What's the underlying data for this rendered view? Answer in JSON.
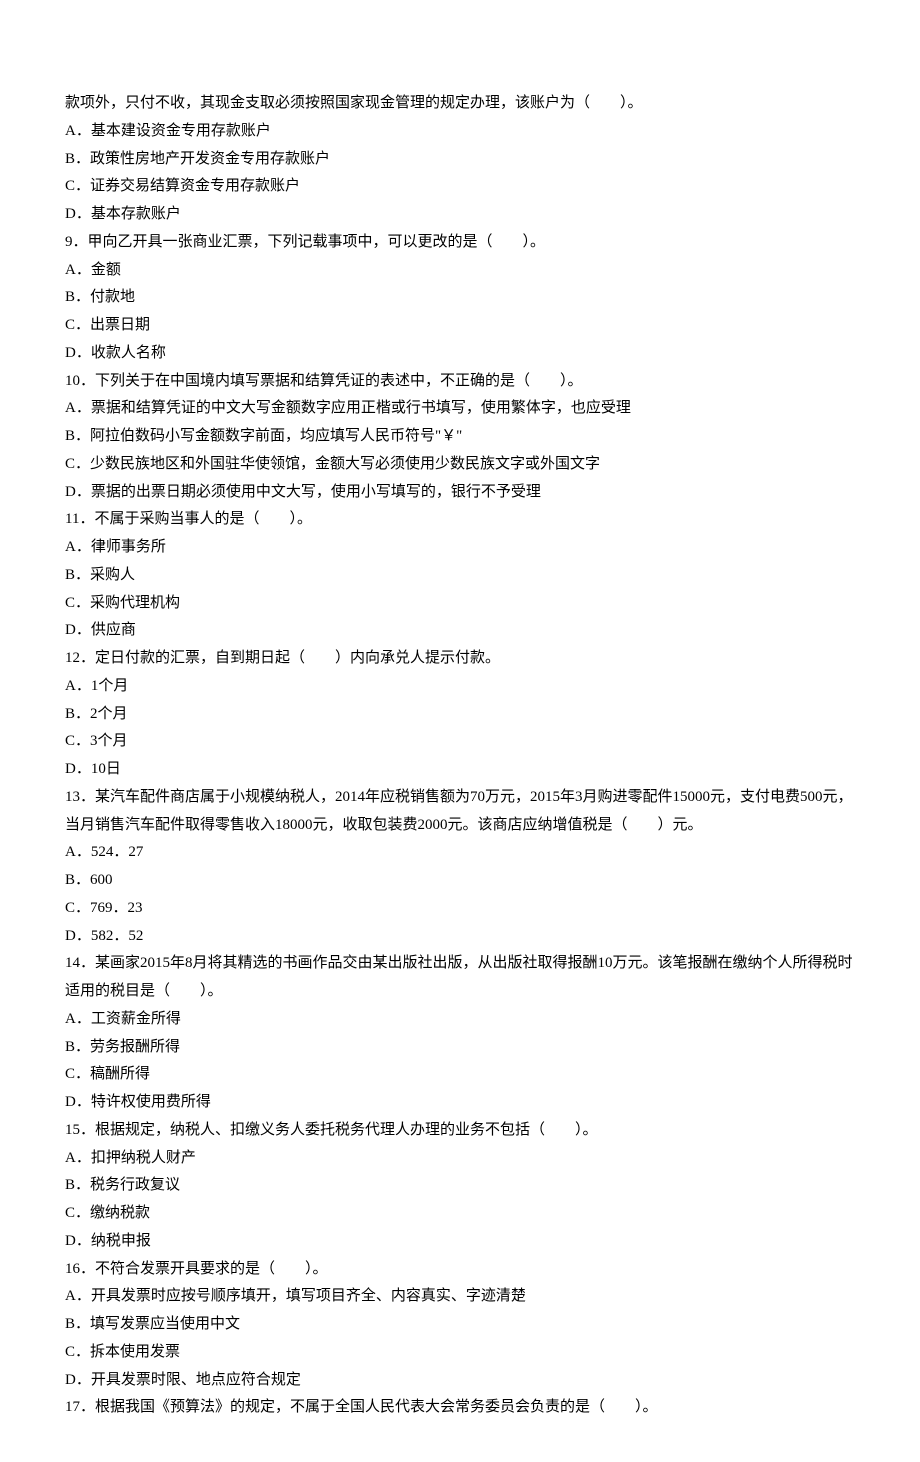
{
  "lines": [
    "款项外，只付不收，其现金支取必须按照国家现金管理的规定办理，该账户为（　　）。",
    "A．基本建设资金专用存款账户",
    "B．政策性房地产开发资金专用存款账户",
    "C．证券交易结算资金专用存款账户",
    "D．基本存款账户",
    "9．甲向乙开具一张商业汇票，下列记载事项中，可以更改的是（　　）。",
    "A．金额",
    "B．付款地",
    "C．出票日期",
    "D．收款人名称",
    "10．下列关于在中国境内填写票据和结算凭证的表述中，不正确的是（　　）。",
    "A．票据和结算凭证的中文大写金额数字应用正楷或行书填写，使用繁体字，也应受理",
    "B．阿拉伯数码小写金额数字前面，均应填写人民币符号\"￥\"",
    "C．少数民族地区和外国驻华使领馆，金额大写必须使用少数民族文字或外国文字",
    "D．票据的出票日期必须使用中文大写，使用小写填写的，银行不予受理",
    "11．不属于采购当事人的是（　　）。",
    "A．律师事务所",
    "B．采购人",
    "C．采购代理机构",
    "D．供应商",
    "12．定日付款的汇票，自到期日起（　　）内向承兑人提示付款。",
    "A．1个月",
    "B．2个月",
    "C．3个月",
    "D．10日",
    "13．某汽车配件商店属于小规模纳税人，2014年应税销售额为70万元，2015年3月购进零配件15000元，支付电费500元，当月销售汽车配件取得零售收入18000元，收取包装费2000元。该商店应纳增值税是（　　）元。",
    "A．524．27",
    "B．600",
    "C．769．23",
    "D．582．52",
    "14．某画家2015年8月将其精选的书画作品交由某出版社出版，从出版社取得报酬10万元。该笔报酬在缴纳个人所得税时适用的税目是（　　）。",
    "A．工资薪金所得",
    "B．劳务报酬所得",
    "C．稿酬所得",
    "D．特许权使用费所得",
    "15．根据规定，纳税人、扣缴义务人委托税务代理人办理的业务不包括（　　）。",
    "A．扣押纳税人财产",
    "B．税务行政复议",
    "C．缴纳税款",
    "D．纳税申报",
    "16．不符合发票开具要求的是（　　）。",
    "A．开具发票时应按号顺序填开，填写项目齐全、内容真实、字迹清楚",
    "B．填写发票应当使用中文",
    "C．拆本使用发票",
    "D．开具发票时限、地点应符合规定",
    "17．根据我国《预算法》的规定，不属于全国人民代表大会常务委员会负责的是（　　）。"
  ]
}
